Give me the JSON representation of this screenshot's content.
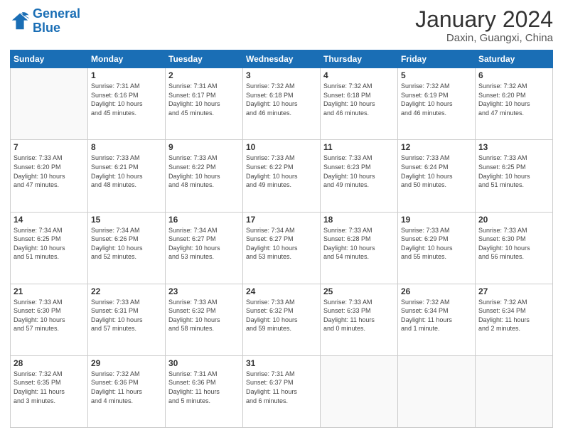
{
  "logo": {
    "line1": "General",
    "line2": "Blue"
  },
  "header": {
    "month_year": "January 2024",
    "location": "Daxin, Guangxi, China"
  },
  "weekdays": [
    "Sunday",
    "Monday",
    "Tuesday",
    "Wednesday",
    "Thursday",
    "Friday",
    "Saturday"
  ],
  "weeks": [
    [
      {
        "num": "",
        "info": ""
      },
      {
        "num": "1",
        "info": "Sunrise: 7:31 AM\nSunset: 6:16 PM\nDaylight: 10 hours\nand 45 minutes."
      },
      {
        "num": "2",
        "info": "Sunrise: 7:31 AM\nSunset: 6:17 PM\nDaylight: 10 hours\nand 45 minutes."
      },
      {
        "num": "3",
        "info": "Sunrise: 7:32 AM\nSunset: 6:18 PM\nDaylight: 10 hours\nand 46 minutes."
      },
      {
        "num": "4",
        "info": "Sunrise: 7:32 AM\nSunset: 6:18 PM\nDaylight: 10 hours\nand 46 minutes."
      },
      {
        "num": "5",
        "info": "Sunrise: 7:32 AM\nSunset: 6:19 PM\nDaylight: 10 hours\nand 46 minutes."
      },
      {
        "num": "6",
        "info": "Sunrise: 7:32 AM\nSunset: 6:20 PM\nDaylight: 10 hours\nand 47 minutes."
      }
    ],
    [
      {
        "num": "7",
        "info": "Sunrise: 7:33 AM\nSunset: 6:20 PM\nDaylight: 10 hours\nand 47 minutes."
      },
      {
        "num": "8",
        "info": "Sunrise: 7:33 AM\nSunset: 6:21 PM\nDaylight: 10 hours\nand 48 minutes."
      },
      {
        "num": "9",
        "info": "Sunrise: 7:33 AM\nSunset: 6:22 PM\nDaylight: 10 hours\nand 48 minutes."
      },
      {
        "num": "10",
        "info": "Sunrise: 7:33 AM\nSunset: 6:22 PM\nDaylight: 10 hours\nand 49 minutes."
      },
      {
        "num": "11",
        "info": "Sunrise: 7:33 AM\nSunset: 6:23 PM\nDaylight: 10 hours\nand 49 minutes."
      },
      {
        "num": "12",
        "info": "Sunrise: 7:33 AM\nSunset: 6:24 PM\nDaylight: 10 hours\nand 50 minutes."
      },
      {
        "num": "13",
        "info": "Sunrise: 7:33 AM\nSunset: 6:25 PM\nDaylight: 10 hours\nand 51 minutes."
      }
    ],
    [
      {
        "num": "14",
        "info": "Sunrise: 7:34 AM\nSunset: 6:25 PM\nDaylight: 10 hours\nand 51 minutes."
      },
      {
        "num": "15",
        "info": "Sunrise: 7:34 AM\nSunset: 6:26 PM\nDaylight: 10 hours\nand 52 minutes."
      },
      {
        "num": "16",
        "info": "Sunrise: 7:34 AM\nSunset: 6:27 PM\nDaylight: 10 hours\nand 53 minutes."
      },
      {
        "num": "17",
        "info": "Sunrise: 7:34 AM\nSunset: 6:27 PM\nDaylight: 10 hours\nand 53 minutes."
      },
      {
        "num": "18",
        "info": "Sunrise: 7:33 AM\nSunset: 6:28 PM\nDaylight: 10 hours\nand 54 minutes."
      },
      {
        "num": "19",
        "info": "Sunrise: 7:33 AM\nSunset: 6:29 PM\nDaylight: 10 hours\nand 55 minutes."
      },
      {
        "num": "20",
        "info": "Sunrise: 7:33 AM\nSunset: 6:30 PM\nDaylight: 10 hours\nand 56 minutes."
      }
    ],
    [
      {
        "num": "21",
        "info": "Sunrise: 7:33 AM\nSunset: 6:30 PM\nDaylight: 10 hours\nand 57 minutes."
      },
      {
        "num": "22",
        "info": "Sunrise: 7:33 AM\nSunset: 6:31 PM\nDaylight: 10 hours\nand 57 minutes."
      },
      {
        "num": "23",
        "info": "Sunrise: 7:33 AM\nSunset: 6:32 PM\nDaylight: 10 hours\nand 58 minutes."
      },
      {
        "num": "24",
        "info": "Sunrise: 7:33 AM\nSunset: 6:32 PM\nDaylight: 10 hours\nand 59 minutes."
      },
      {
        "num": "25",
        "info": "Sunrise: 7:33 AM\nSunset: 6:33 PM\nDaylight: 11 hours\nand 0 minutes."
      },
      {
        "num": "26",
        "info": "Sunrise: 7:32 AM\nSunset: 6:34 PM\nDaylight: 11 hours\nand 1 minute."
      },
      {
        "num": "27",
        "info": "Sunrise: 7:32 AM\nSunset: 6:34 PM\nDaylight: 11 hours\nand 2 minutes."
      }
    ],
    [
      {
        "num": "28",
        "info": "Sunrise: 7:32 AM\nSunset: 6:35 PM\nDaylight: 11 hours\nand 3 minutes."
      },
      {
        "num": "29",
        "info": "Sunrise: 7:32 AM\nSunset: 6:36 PM\nDaylight: 11 hours\nand 4 minutes."
      },
      {
        "num": "30",
        "info": "Sunrise: 7:31 AM\nSunset: 6:36 PM\nDaylight: 11 hours\nand 5 minutes."
      },
      {
        "num": "31",
        "info": "Sunrise: 7:31 AM\nSunset: 6:37 PM\nDaylight: 11 hours\nand 6 minutes."
      },
      {
        "num": "",
        "info": ""
      },
      {
        "num": "",
        "info": ""
      },
      {
        "num": "",
        "info": ""
      }
    ]
  ]
}
